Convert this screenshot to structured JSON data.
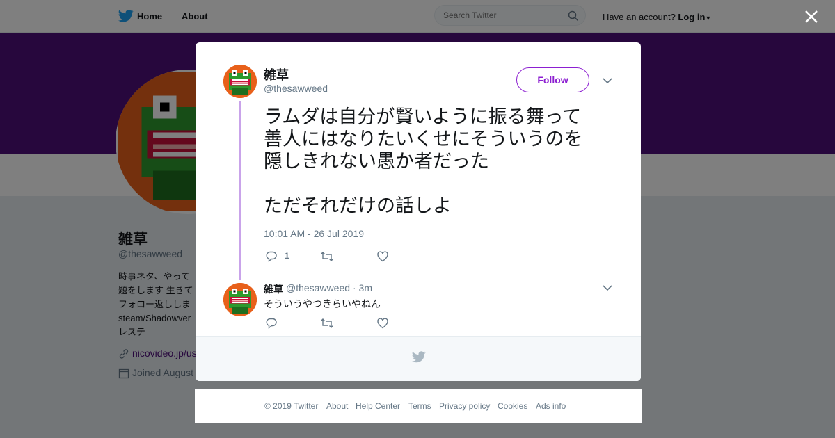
{
  "topbar": {
    "home_label": "Home",
    "about_label": "About",
    "search_placeholder": "Search Twitter",
    "have_account": "Have an account?",
    "login_label": "Log in"
  },
  "profile": {
    "name": "雑草",
    "handle": "@thesawweed",
    "bio_lines": [
      "時事ネタ、やって",
      "題をします 生きて",
      "フォロー返ししま",
      "steam/Shadowver",
      "レステ"
    ],
    "link": "nicovideo.jp/us",
    "joined": "Joined August"
  },
  "tweet": {
    "author_name": "雑草",
    "author_handle": "@thesawweed",
    "follow_label": "Follow",
    "text": "ラムダは自分が賢いように振る舞って\n善人にはなりたいくせにそういうのを\n隠しきれない愚か者だった\n\nただそれだけの話しよ",
    "timestamp": "10:01 AM - 26 Jul 2019",
    "reply_count": "1"
  },
  "reply": {
    "author_name": "雑草",
    "author_handle": "@thesawweed",
    "time": "· 3m",
    "text": "そういうやつきらいやねん"
  },
  "footer": {
    "copyright": "© 2019 Twitter",
    "about": "About",
    "help": "Help Center",
    "terms": "Terms",
    "privacy": "Privacy policy",
    "cookies": "Cookies",
    "ads": "Ads info"
  },
  "colors": {
    "banner": "#4f0e7b",
    "accent": "#8c1fd1",
    "thread_line": "#c9a3ea",
    "twitter_blue": "#1da1f2"
  },
  "icons": [
    "twitter-bird-icon",
    "search-icon",
    "close-icon",
    "chevron-down-icon",
    "reply-icon",
    "retweet-icon",
    "like-icon",
    "link-icon",
    "calendar-icon"
  ]
}
